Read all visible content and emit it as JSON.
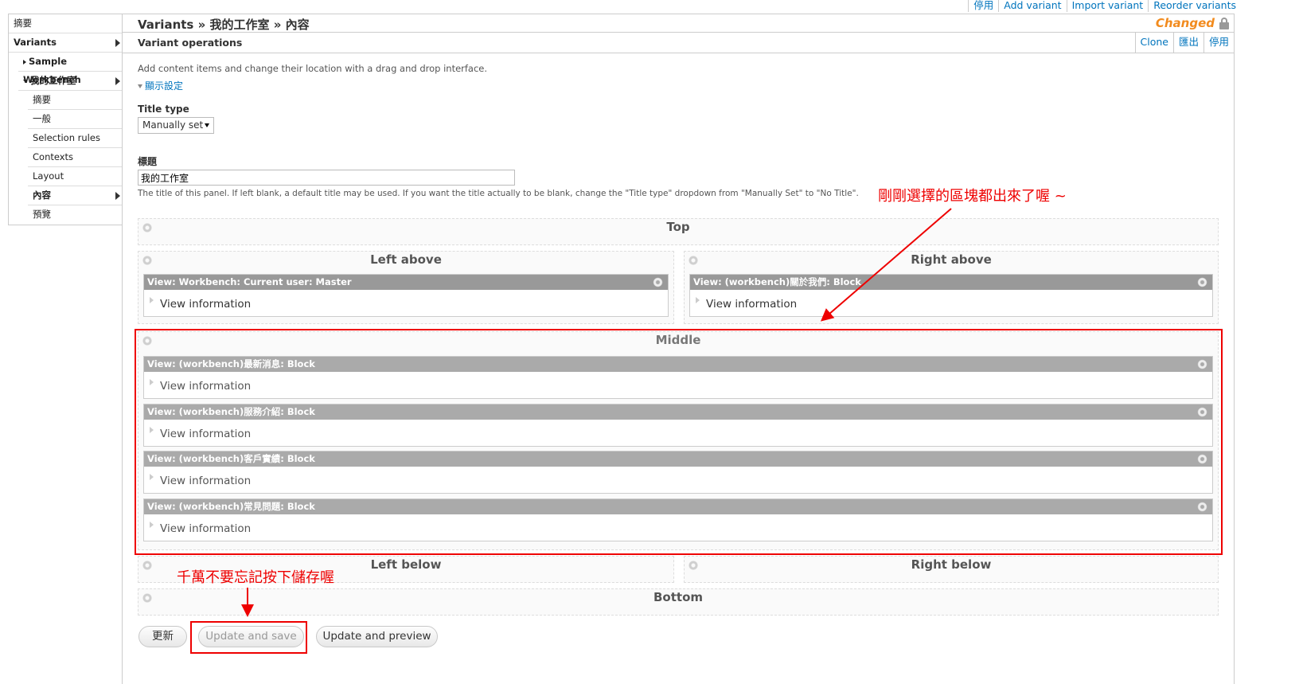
{
  "top_links": [
    "停用",
    "Add variant",
    "Import variant",
    "Reorder variants"
  ],
  "sidebar": {
    "summary": "摘要",
    "variants": "Variants",
    "sample_workbench": "Sample Workbench",
    "my_studio": "我的工作室",
    "sub_items": [
      "摘要",
      "一般",
      "Selection rules",
      "Contexts",
      "Layout",
      "內容",
      "預覽"
    ]
  },
  "header": {
    "title": "Variants » 我的工作室 » 內容",
    "status": "Changed",
    "section": "Variant operations",
    "ops": [
      "Clone",
      "匯出",
      "停用"
    ]
  },
  "form": {
    "description": "Add content items and change their location with a drag and drop interface.",
    "display_settings": "顯示設定",
    "title_type_label": "Title type",
    "title_type_value": "Manually set",
    "title_label": "標題",
    "title_value": "我的工作室",
    "title_hint": "The title of this panel. If left blank, a default title may be used. If you want the title actually to be blank, change the \"Title type\" dropdown from \"Manually Set\" to \"No Title\"."
  },
  "regions": {
    "top": "Top",
    "left_above": "Left above",
    "right_above": "Right above",
    "middle": "Middle",
    "left_below": "Left below",
    "right_below": "Right below",
    "bottom": "Bottom"
  },
  "panes": {
    "left_above": "View: Workbench: Current user: Master",
    "right_above": "View: (workbench)關於我們: Block",
    "middle": [
      "View: (workbench)最新消息: Block",
      "View: (workbench)服務介紹: Block",
      "View: (workbench)客戶實績: Block",
      "View: (workbench)常見問題: Block"
    ],
    "view_info": "View information"
  },
  "annotations": {
    "blocks_note": "剛剛選擇的區塊都出來了喔 ~",
    "save_note": "千萬不要忘記按下儲存喔"
  },
  "buttons": {
    "update": "更新",
    "update_save": "Update and save",
    "update_preview": "Update and preview"
  }
}
